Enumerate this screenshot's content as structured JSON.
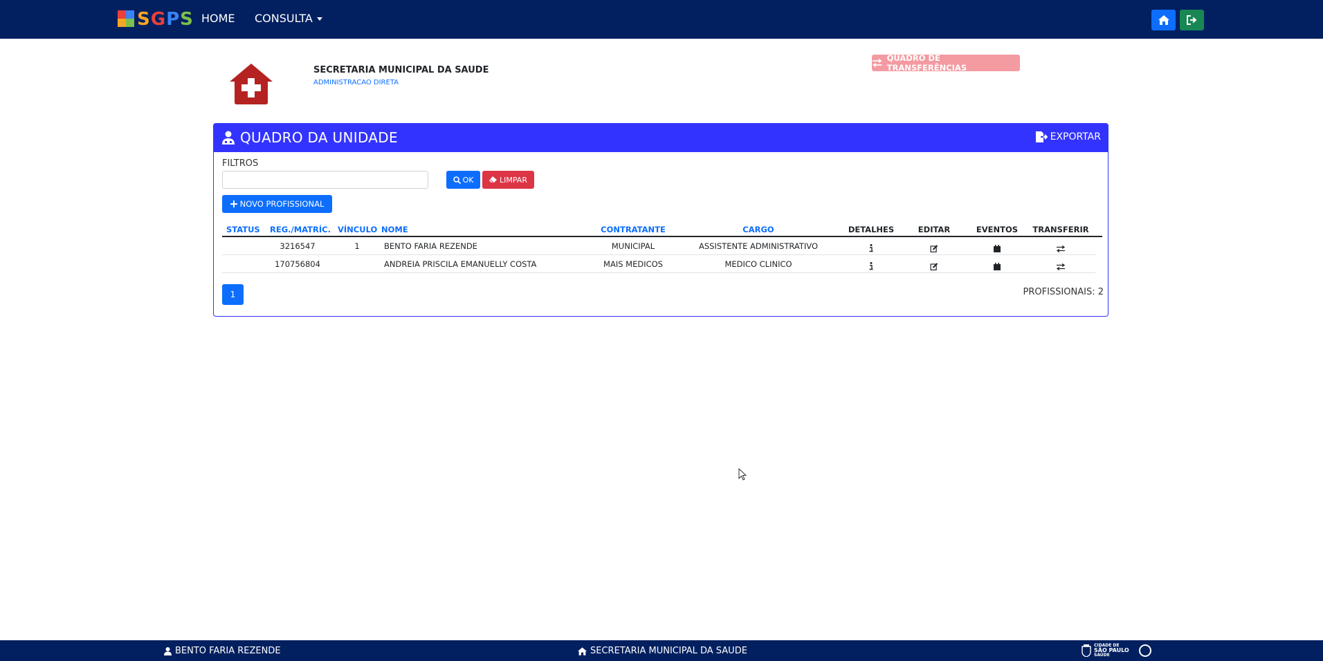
{
  "colors": {
    "navbar": "#02205f",
    "primary": "#0d6efd",
    "danger": "#dc3545",
    "panel": "#3333ff",
    "success": "#198754",
    "transfer": "#f49aa1"
  },
  "navbar": {
    "brand": "SGPS",
    "home_label": "HOME",
    "consulta_label": "CONSULTA",
    "home_button_icon": "home-icon",
    "logout_button_icon": "sign-out-icon"
  },
  "unit": {
    "name": "SECRETARIA MUNICIPAL DA SAUDE",
    "subtitle": "ADMINISTRACAO DIRETA",
    "logo_icon": "clinic-house-icon",
    "transfer_board_label": "QUADRO DE TRANSFERÊNCIAS"
  },
  "panel": {
    "title": "QUADRO DA UNIDADE",
    "export_label": "EXPORTAR",
    "filters_label": "FILTROS",
    "filter_placeholder": "",
    "ok_label": "OK",
    "clear_label": "LIMPAR",
    "new_label": "NOVO PROFISSIONAL"
  },
  "table": {
    "headers": {
      "status": "STATUS",
      "reg": "REG./MATRÍC.",
      "vinculo": "VÍNCULO",
      "nome": "NOME",
      "contratante": "CONTRATANTE",
      "cargo": "CARGO",
      "detalhes": "DETALHES",
      "editar": "EDITAR",
      "eventos": "EVENTOS",
      "transferir": "TRANSFERIR"
    },
    "rows": [
      {
        "status": "",
        "reg": "3216547",
        "vinculo": "1",
        "nome": "BENTO FARIA REZENDE",
        "contratante": "MUNICIPAL",
        "cargo": "ASSISTENTE ADMINISTRATIVO"
      },
      {
        "status": "",
        "reg": "170756804",
        "vinculo": "",
        "nome": "ANDREIA PRISCILA EMANUELLY COSTA",
        "contratante": "MAIS MEDICOS",
        "cargo": "MEDICO CLINICO"
      }
    ]
  },
  "pagination": {
    "current_page": "1"
  },
  "summary": {
    "count_label": "PROFISSIONAIS: 2"
  },
  "footer": {
    "user": "BENTO FARIA REZENDE",
    "unit": "SECRETARIA MUNICIPAL DA SAUDE",
    "brand_line1": "CIDADE DE",
    "brand_line2": "SÃO PAULO",
    "brand_line3": "SAÚDE"
  }
}
